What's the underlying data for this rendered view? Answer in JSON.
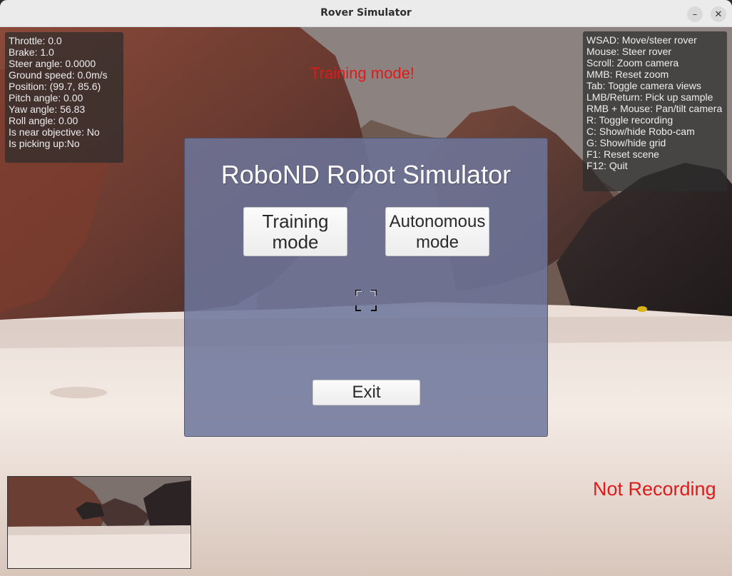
{
  "window": {
    "title": "Rover Simulator",
    "minimize_glyph": "–",
    "close_glyph": "✕"
  },
  "hud_telemetry": [
    "Throttle: 0.0",
    "Brake: 1.0",
    "Steer angle: 0.0000",
    "Ground speed: 0.0m/s",
    "Position: (99.7, 85.6)",
    "Pitch angle: 0.00",
    "Yaw angle: 56.83",
    "Roll angle: 0.00",
    "Is near objective: No",
    "Is picking up:No"
  ],
  "hud_controls": [
    "WSAD: Move/steer rover",
    "Mouse: Steer rover",
    "Scroll: Zoom camera",
    "MMB: Reset zoom",
    "Tab: Toggle camera views",
    "LMB/Return: Pick up sample",
    "RMB + Mouse: Pan/tilt camera",
    "R: Toggle recording",
    "C: Show/hide Robo-cam",
    "G: Show/hide grid",
    "F1: Reset scene",
    "F12: Quit"
  ],
  "status": {
    "mode_label": "Training mode!",
    "recording_label": "Not Recording",
    "label_color": "#e01a1a"
  },
  "menu": {
    "title": "RoboND Robot Simulator",
    "training_button": "Training\nmode",
    "autonomous_button": "Autonomous\nmode",
    "exit_button": "Exit",
    "panel_color": "#6e769b"
  },
  "icons": {
    "crosshair": "reticle-icon"
  }
}
